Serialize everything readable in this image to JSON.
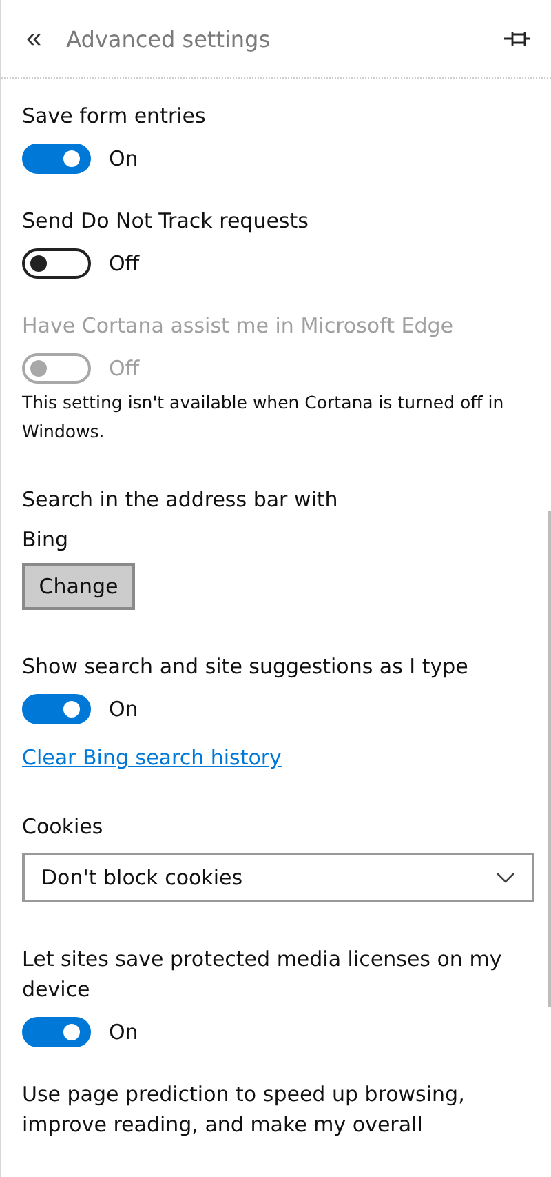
{
  "header": {
    "back": "«",
    "title": "Advanced settings"
  },
  "items": [
    {
      "kind": "toggle",
      "label": "Save form entries",
      "on": true,
      "disabled": false,
      "state": "On"
    },
    {
      "kind": "toggle",
      "label": "Send Do Not Track requests",
      "on": false,
      "disabled": false,
      "state": "Off"
    },
    {
      "kind": "toggle",
      "label": "Have Cortana assist me in Microsoft Edge",
      "on": false,
      "disabled": true,
      "state": "Off",
      "note": "This setting isn't available when Cortana is turned off in Windows."
    },
    {
      "kind": "choice",
      "label": "Search in the address bar with",
      "value": "Bing",
      "button": "Change"
    },
    {
      "kind": "toggle",
      "label": "Show search and site suggestions as I type",
      "on": true,
      "disabled": false,
      "state": "On"
    },
    {
      "kind": "link",
      "label": "Clear Bing search history"
    },
    {
      "kind": "select",
      "label": "Cookies",
      "value": "Don't block cookies"
    },
    {
      "kind": "toggle",
      "label": "Let sites save protected media licenses on my device",
      "on": true,
      "disabled": false,
      "state": "On"
    },
    {
      "kind": "text",
      "label": "Use page prediction to speed up browsing, improve reading, and make my overall"
    }
  ]
}
